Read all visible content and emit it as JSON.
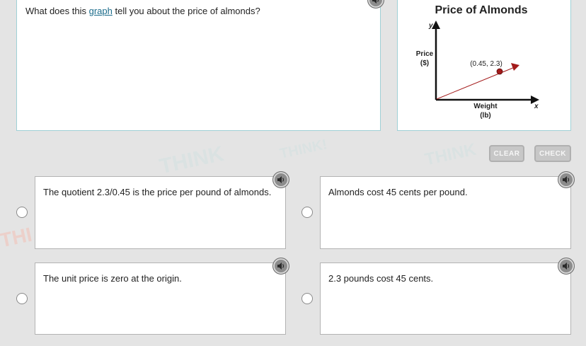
{
  "question": {
    "prefix": "What does this ",
    "link": "graph",
    "suffix": " tell you about the price of almonds?"
  },
  "graph": {
    "title": "Price of Almonds",
    "y_axis_letter": "y",
    "x_axis_letter": "x",
    "y_label_line1": "Price",
    "y_label_line2": "($)",
    "x_label_line1": "Weight",
    "x_label_line2": "(lb)",
    "point_label": "(0.45, 2.3)",
    "point": {
      "x": 0.45,
      "y": 2.3
    },
    "line_color": "#a31a1a"
  },
  "controls": {
    "clear_label": "CLEAR",
    "check_label": "CHECK"
  },
  "answers": [
    {
      "text": "The quotient 2.3/0.45 is the price per pound of almonds."
    },
    {
      "text": "Almonds cost 45 cents per pound."
    },
    {
      "text": "The unit price is zero at the origin."
    },
    {
      "text": "2.3 pounds cost 45 cents."
    }
  ],
  "background": {
    "doodles": [
      "THINK",
      "THINK!",
      "THI",
      "THINK"
    ]
  },
  "colors": {
    "panel_border": "#9fd0d6",
    "link": "#1a6b8a",
    "page_background": "#e4e4e4"
  }
}
